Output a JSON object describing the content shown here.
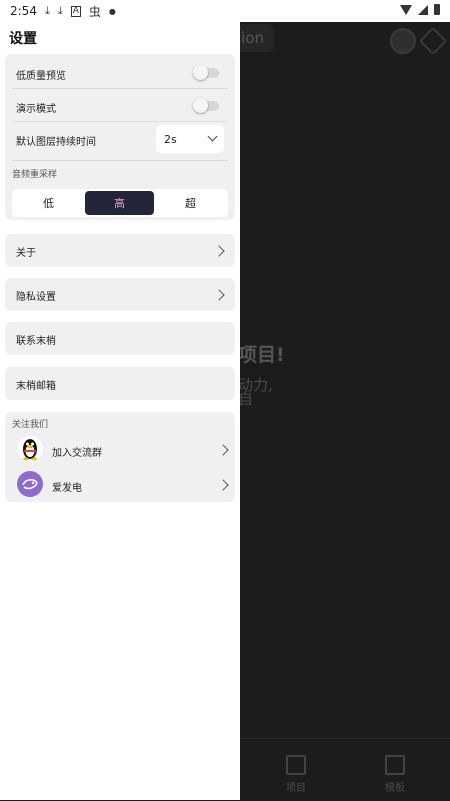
{
  "status_bar": {
    "time": "2:54",
    "icons": [
      "download-icon",
      "download-icon",
      "a-icon",
      "bug-icon",
      "dot-icon"
    ],
    "right_icons": [
      "wifi-icon",
      "signal-icon",
      "battery-icon"
    ]
  },
  "background": {
    "pill_text": "ion",
    "headline": "项目!",
    "line1": "动力,",
    "line2": "自",
    "tab1": "项目",
    "tab2": "模板"
  },
  "drawer": {
    "title": "设置",
    "settings": {
      "low_quality_preview": {
        "label": "低质量预览",
        "on": false
      },
      "demo_mode": {
        "label": "演示模式",
        "on": false
      },
      "default_layer_duration": {
        "label": "默认图层持续时间",
        "value": "2s"
      },
      "audio_resample": {
        "label": "音频重采样",
        "options": [
          "低",
          "高",
          "超"
        ],
        "selected": "高"
      }
    },
    "menu": {
      "about": "关于",
      "privacy": "隐私设置",
      "contact": "联系末梢",
      "mailbox": "末梢邮箱"
    },
    "follow": {
      "title": "关注我们",
      "items": [
        {
          "label": "加入交流群",
          "icon": "qq-penguin-icon"
        },
        {
          "label": "爱发电",
          "icon": "afdian-icon"
        }
      ]
    }
  }
}
